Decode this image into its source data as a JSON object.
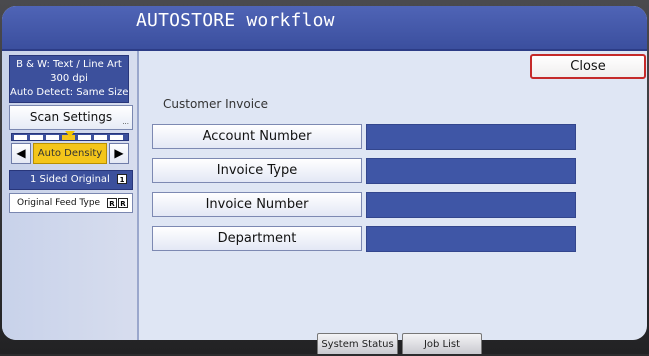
{
  "window": {
    "title": "AUTOSTORE workflow"
  },
  "sidebar": {
    "mode_lines": [
      "B & W: Text / Line Art",
      "300 dpi",
      "Auto Detect: Same Size"
    ],
    "scan_settings_label": "Scan Settings",
    "scan_settings_more": "...",
    "density": {
      "label": "Auto Density",
      "left_arrow": "◀",
      "right_arrow": "▶"
    },
    "sided_label": "1 Sided Original",
    "sided_icon": "1",
    "feed_label": "Original Feed Type",
    "feed_icons": [
      "R",
      "R"
    ]
  },
  "main": {
    "close_label": "Close",
    "section_label": "Customer Invoice",
    "fields": [
      {
        "label": "Account Number",
        "value": ""
      },
      {
        "label": "Invoice Type",
        "value": ""
      },
      {
        "label": "Invoice Number",
        "value": ""
      },
      {
        "label": "Department",
        "value": ""
      }
    ]
  },
  "bottom_bar": {
    "system_status_label": "System Status",
    "job_list_label": "Job List"
  },
  "colors": {
    "title_bar": "#3b4f9e",
    "accent_blue": "#3f56a6",
    "close_border": "#c52a2a",
    "density_highlight": "#f4c51a",
    "screen_bg": "#dfe6f4"
  }
}
